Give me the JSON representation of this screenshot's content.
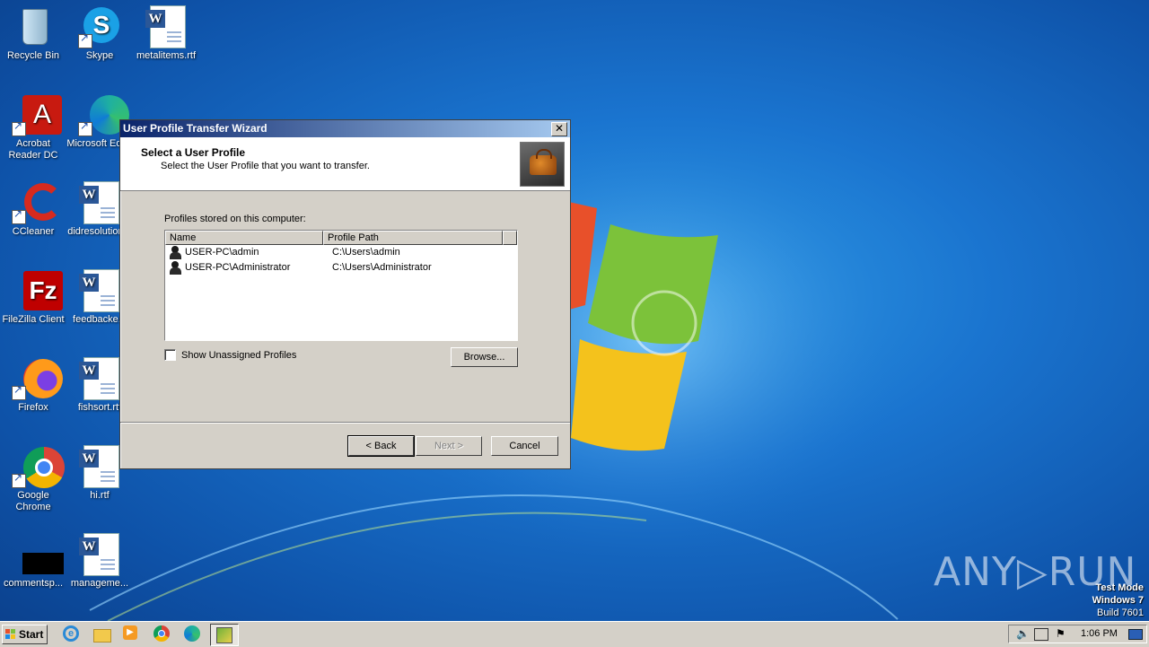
{
  "desktop": {
    "icons": [
      {
        "label": "Recycle Bin"
      },
      {
        "label": "Skype"
      },
      {
        "label": "metalitems.rtf"
      },
      {
        "label": "Acrobat Reader DC"
      },
      {
        "label": "Microsoft Edge"
      },
      {
        "label": "CCleaner"
      },
      {
        "label": "didresolution..."
      },
      {
        "label": "FileZilla Client"
      },
      {
        "label": "feedbacke..."
      },
      {
        "label": "Firefox"
      },
      {
        "label": "fishsort.rtf"
      },
      {
        "label": "Google Chrome"
      },
      {
        "label": "hi.rtf"
      },
      {
        "label": "commentsp..."
      },
      {
        "label": "manageme..."
      }
    ],
    "watermark": {
      "line1": "Test Mode",
      "line2": "Windows 7",
      "line3": "Build 7601",
      "brand": "ANY▷RUN"
    }
  },
  "dialog": {
    "title": "User Profile Transfer Wizard",
    "header_title": "Select a User Profile",
    "header_subtitle": "Select the User Profile that you want to transfer.",
    "profiles_label": "Profiles stored on this computer:",
    "columns": [
      "Name",
      "Profile Path"
    ],
    "rows": [
      {
        "name": "USER-PC\\admin",
        "path": "C:\\Users\\admin"
      },
      {
        "name": "USER-PC\\Administrator",
        "path": "C:\\Users\\Administrator"
      }
    ],
    "checkbox_label": "Show Unassigned Profiles",
    "checkbox_checked": false,
    "browse_label": "Browse...",
    "back_label": "< Back",
    "next_label": "Next >",
    "cancel_label": "Cancel"
  },
  "taskbar": {
    "start_label": "Start",
    "clock": "1:06 PM",
    "pinned": [
      "internet-explorer-icon",
      "explorer-icon",
      "media-player-icon",
      "chrome-icon",
      "edge-icon",
      "wizard-app-icon"
    ]
  }
}
